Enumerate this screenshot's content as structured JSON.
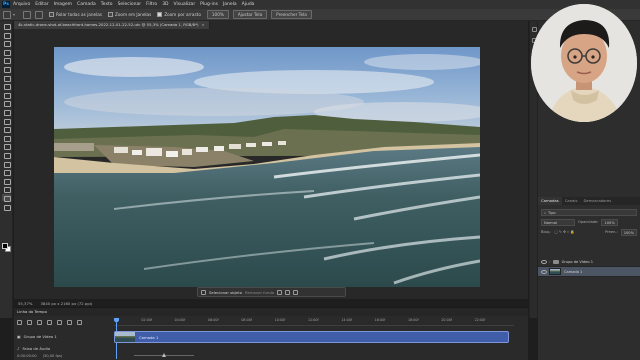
{
  "menubar": {
    "logo": "Ps",
    "items": [
      "Arquivo",
      "Editar",
      "Imagem",
      "Camada",
      "Texto",
      "Selecionar",
      "Filtro",
      "3D",
      "Visualizar",
      "Plug-ins",
      "Janela",
      "Ajuda"
    ]
  },
  "options": {
    "scroll_all": "Rolar todas as janelas",
    "zoom_resize": "Zoom em Janelas",
    "scrubby": "Zoom por arrasto",
    "zoom_level_btn": "100%",
    "fit_btn": "Ajustar Tela",
    "fill_btn": "Preencher Tela"
  },
  "document": {
    "tab_title": "4k-static-drone-shot-of-beachfront-homes-2022-12-01-22-52-utc @ 55,3% (Camada 1, RGB/8*)",
    "close": "×",
    "zoom": "55,37%",
    "dims": "3840 px x 2160 px (72 ppi)"
  },
  "contextbar": {
    "select_subject": "Selecionar objeto",
    "remove_bg": "Remover fundo"
  },
  "layers": {
    "tabs": [
      "Camadas",
      "Canais",
      "Demarcadores"
    ],
    "filter_kind": "Tipo",
    "blend_mode": "Normal",
    "opacity_label": "Opacidade:",
    "opacity_value": "100%",
    "lock_label": "Bloq.:",
    "fill_label": "Preen.:",
    "fill_value": "100%",
    "rows": [
      {
        "name": "Grupo de Vídeo 1"
      },
      {
        "name": "Camada 1"
      }
    ]
  },
  "timeline": {
    "title": "Linha do Tempo",
    "video_group": "Grupo de Vídeo 1",
    "audio_track": "Faixa de Áudio",
    "clip_name": "Camada 1",
    "timecode": "0:00:00:00",
    "fps": "(30,00 fps)",
    "ticks": [
      "02:00f",
      "04:00f",
      "06:00f",
      "08:00f",
      "10:00f",
      "12:00f",
      "14:00f",
      "16:00f",
      "18:00f",
      "20:00f",
      "22:00f"
    ]
  },
  "colors": {
    "accent": "#31a8ff",
    "clip": "#3f5da8",
    "selected_layer": "#4b5564"
  }
}
